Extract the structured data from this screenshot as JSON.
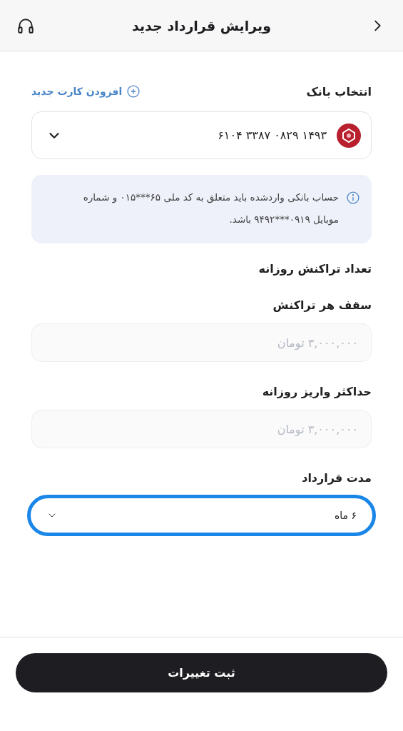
{
  "header": {
    "title": "ویرایش قرارداد جدید"
  },
  "bank": {
    "label": "انتخاب بانک",
    "add_card": "افزودن کارت جدید",
    "card_number": "۶۱۰۴ ۳۳۸۷ ۰۸۲۹ ۱۴۹۳"
  },
  "notice": "حساب بانکی واردشده باید متعلق به کد ملی ۶۵***۰۱۵ و شماره موبایل ۰۹۱۹***۹۴۹۲ باشد.",
  "section_title": "تعداد تراکنش روزانه",
  "fields": [
    {
      "label": "سقف هر تراکنش",
      "placeholder": "۳,۰۰۰,۰۰۰ تومان"
    },
    {
      "label": "حداکثر واریز روزانه",
      "placeholder": "۳,۰۰۰,۰۰۰ تومان"
    }
  ],
  "duration": {
    "label": "مدت قرارداد",
    "value": "۶ ماه",
    "focused": true
  },
  "submit": "ثبت تغییرات"
}
